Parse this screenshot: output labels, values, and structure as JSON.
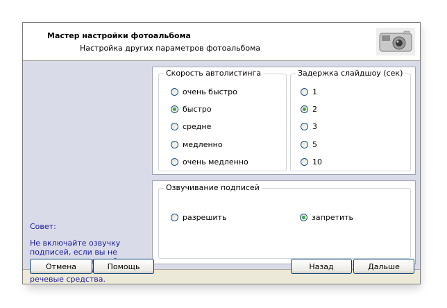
{
  "header": {
    "title": "Мастер настройки фотоальбома",
    "subtitle": "Настройка других параметров фотоальбома",
    "icon": "camera-icon"
  },
  "tip": {
    "title": "Совет:",
    "text": "Не включайте озвучку подписей, если вы не уверены, что в вашей Windows установ-лены речевые средства."
  },
  "speed_group": {
    "legend": "Скорость автолистинга",
    "options": [
      "очень быстро",
      "быстро",
      "средне",
      "медленно",
      "очень медленно"
    ],
    "selected": "быстро"
  },
  "delay_group": {
    "legend": "Задержка слайдшоу (сек)",
    "options": [
      "1",
      "2",
      "3",
      "5",
      "10"
    ],
    "selected": "2"
  },
  "voice_group": {
    "legend": "Озвучивание подписей",
    "options": [
      "разрешить",
      "запретить"
    ],
    "selected": "запретить"
  },
  "buttons": {
    "cancel": "Отмена",
    "help": "Помощь",
    "back": "Назад",
    "next": "Дальше"
  }
}
